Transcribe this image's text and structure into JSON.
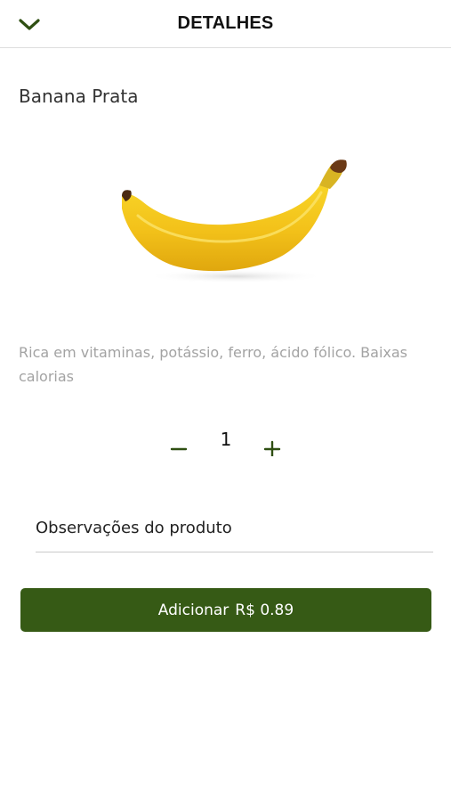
{
  "header": {
    "title": "DETALHES",
    "back_icon": "chevron-down-icon"
  },
  "product": {
    "name": "Banana Prata",
    "image": "banana-image",
    "description": "Rica em vitaminas, potássio, ferro, ácido fólico. Baixas calorias"
  },
  "quantity": {
    "value": "1",
    "decrement_icon": "minus-icon",
    "increment_icon": "plus-icon"
  },
  "observations": {
    "placeholder": "Observações do produto",
    "value": ""
  },
  "add_button": {
    "label": "Adicionar",
    "price": "R$ 0.89"
  },
  "colors": {
    "accent": "#365a15",
    "description_text": "#a3a3a3",
    "divider": "#dedede"
  }
}
